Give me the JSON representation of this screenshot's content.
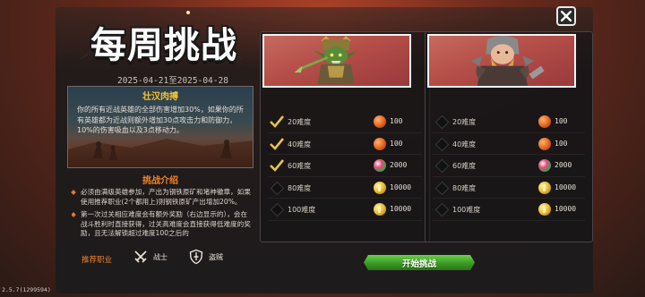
{
  "header": {
    "title": "每周挑战",
    "date_range": "2025-04-21至2025-04-28"
  },
  "buff": {
    "name": "壮汉肉搏",
    "description": "你的所有近战英雄的全部伤害增加30%，如果你的所有英雄都为近战则额外增加30点攻击力和防御力，10%的伤害吸血以及3点移动力。"
  },
  "intro": {
    "title": "挑战介绍",
    "items": [
      "必须由满级英雄参加，产出为钢铁原矿和堵神徽章，如果使用推荐职业(2个都用上)则钢铁原矿产出增加20%。",
      "第一次过关相应难度会有额外奖励（右边显示的），会在战斗胜利时直接获得，过关高难度会直接获得低难度的奖励，且无法解锁超过难度100之后的"
    ]
  },
  "recommend": {
    "label": "推荐职业",
    "classes": [
      {
        "name": "战士",
        "icon": "crossed-swords-icon"
      },
      {
        "name": "盗贼",
        "icon": "dagger-shield-icon"
      }
    ]
  },
  "challenges": [
    {
      "name": "goblin-warrior",
      "tiers": [
        {
          "level": "20难度",
          "reward": "100",
          "gem": "orange",
          "done": true
        },
        {
          "level": "40难度",
          "reward": "100",
          "gem": "orange",
          "done": true
        },
        {
          "level": "60难度",
          "reward": "2000",
          "gem": "pink",
          "done": true
        },
        {
          "level": "80难度",
          "reward": "10000",
          "gem": "gold",
          "done": false
        },
        {
          "level": "100难度",
          "reward": "10000",
          "gem": "gold",
          "done": false
        }
      ]
    },
    {
      "name": "viking-warrior",
      "tiers": [
        {
          "level": "20难度",
          "reward": "100",
          "gem": "orange",
          "done": false
        },
        {
          "level": "40难度",
          "reward": "100",
          "gem": "orange",
          "done": false
        },
        {
          "level": "60难度",
          "reward": "2000",
          "gem": "pink",
          "done": false
        },
        {
          "level": "80难度",
          "reward": "10000",
          "gem": "gold",
          "done": false
        },
        {
          "level": "100难度",
          "reward": "10000",
          "gem": "gold",
          "done": false
        }
      ]
    }
  ],
  "start_button": "开始挑战",
  "version": "2.5.7(1299594)",
  "colors": {
    "accent_orange": "#f0842c",
    "buff_gold": "#f4c233",
    "start_green": "#3c9a26"
  }
}
